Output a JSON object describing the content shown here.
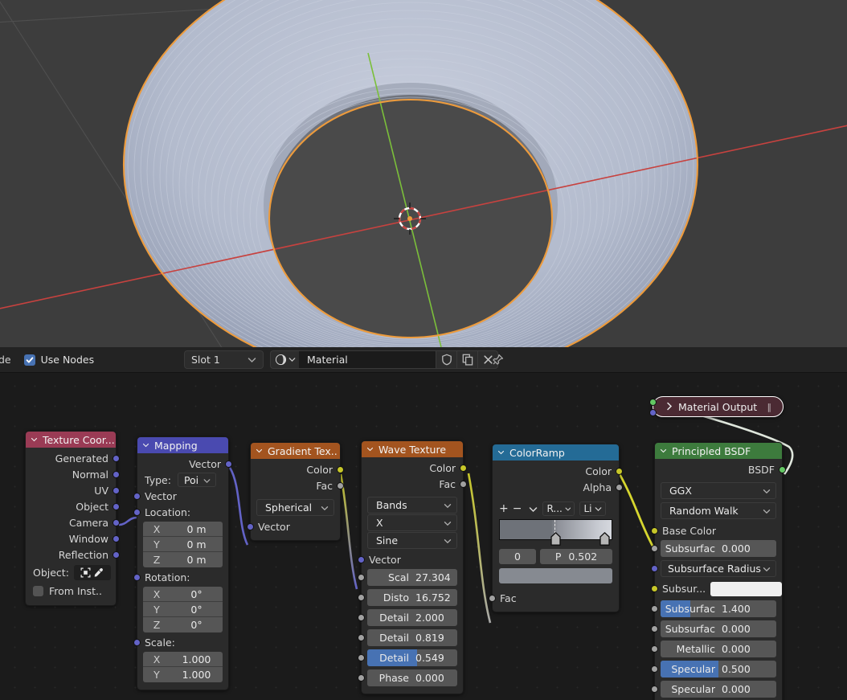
{
  "app": {
    "name": "Blender Shader Editor"
  },
  "viewport": {
    "object": "torus-ring-mesh",
    "selection_outline_color": "#ed9b3c",
    "background_color": "#3d3d3d",
    "cursor": "3d-cursor"
  },
  "header": {
    "mode_label": "de",
    "use_nodes_label": "Use Nodes",
    "use_nodes_checked": true,
    "slot_label": "Slot 1",
    "material_name": "Material",
    "icons": {
      "material_preview": "material-sphere-icon",
      "fake_user": "shield-icon",
      "duplicate": "copy-icon",
      "unlink": "x-icon",
      "pin": "pin-icon"
    }
  },
  "nodes": {
    "texture_coordinate": {
      "title": "Texture Coor...",
      "header_color": "#9a3b55",
      "outputs": [
        "Generated",
        "Normal",
        "UV",
        "Object",
        "Camera",
        "Window",
        "Reflection"
      ],
      "object_label": "Object:",
      "from_instancer_label": "From Inst..",
      "from_instancer_checked": false
    },
    "mapping": {
      "title": "Mapping",
      "header_color": "#4a4ab0",
      "output": "Vector",
      "type_label": "Type:",
      "type_value": "Poi",
      "input_vector": "Vector",
      "location_label": "Location:",
      "location": [
        {
          "axis": "X",
          "value": "0 m"
        },
        {
          "axis": "Y",
          "value": "0 m"
        },
        {
          "axis": "Z",
          "value": "0 m"
        }
      ],
      "rotation_label": "Rotation:",
      "rotation": [
        {
          "axis": "X",
          "value": "0°"
        },
        {
          "axis": "Y",
          "value": "0°"
        },
        {
          "axis": "Z",
          "value": "0°"
        }
      ],
      "scale_label": "Scale:",
      "scale": [
        {
          "axis": "X",
          "value": "1.000"
        },
        {
          "axis": "Y",
          "value": "1.000"
        }
      ]
    },
    "gradient_texture": {
      "title": "Gradient Tex..",
      "header_color": "#a3541f",
      "outputs": [
        "Color",
        "Fac"
      ],
      "type_value": "Spherical",
      "input_vector": "Vector"
    },
    "wave_texture": {
      "title": "Wave Texture",
      "header_color": "#a3541f",
      "outputs": [
        "Color",
        "Fac"
      ],
      "selectors": [
        "Bands",
        "X",
        "Sine"
      ],
      "input_vector": "Vector",
      "params": [
        {
          "label": "Scal",
          "value": "27.304",
          "fill": 0
        },
        {
          "label": "Disto",
          "value": "16.752",
          "fill": 0
        },
        {
          "label": "Detail",
          "value": "2.000",
          "fill": 0
        },
        {
          "label": "Detail",
          "value": "0.819",
          "fill": 0
        },
        {
          "label": "Detail",
          "value": "0.549",
          "fill": 55
        },
        {
          "label": "Phase",
          "value": "0.000",
          "fill": 0
        }
      ]
    },
    "color_ramp": {
      "title": "ColorRamp",
      "header_color": "#246b96",
      "outputs": [
        "Color",
        "Alpha"
      ],
      "tool_add": "+",
      "tool_remove": "−",
      "interpolation_short": "R...",
      "mode_short": "Li",
      "index_value": "0",
      "pos_label": "P",
      "pos_value": "0.502",
      "input_fac": "Fac",
      "stops": [
        {
          "position": 0.502,
          "color": "#8e9199"
        },
        {
          "position": 0.955,
          "color": "#d5d8de"
        }
      ]
    },
    "principled_bsdf": {
      "title": "Principled BSDF",
      "header_color": "#3d7b3d",
      "output": "BSDF",
      "distribution": "GGX",
      "subsurface_method": "Random Walk",
      "base_color_label": "Base Color",
      "subsurface_radius_label": "Subsurface Radius",
      "subsurface_color_label": "Subsur...",
      "params": [
        {
          "label": "Subsurfac",
          "value": "0.000",
          "fill": 0
        },
        {
          "label": "Subsurfac",
          "value": "1.400",
          "fill": 26
        },
        {
          "label": "Subsurfac",
          "value": "0.000",
          "fill": 0
        },
        {
          "label": "Metallic",
          "value": "0.000",
          "fill": 0
        },
        {
          "label": "Specular",
          "value": "0.500",
          "fill": 50
        },
        {
          "label": "Specular",
          "value": "0.000",
          "fill": 0
        }
      ]
    },
    "material_output": {
      "title": "Material Output",
      "header_color": "#4b2a33",
      "collapsed": true,
      "selected": true,
      "menu_glyph": "‖"
    }
  },
  "socket_colors": {
    "vector": "#6363c7",
    "color": "#c7c729",
    "value": "#a1a1a1",
    "shader": "#63c763"
  }
}
